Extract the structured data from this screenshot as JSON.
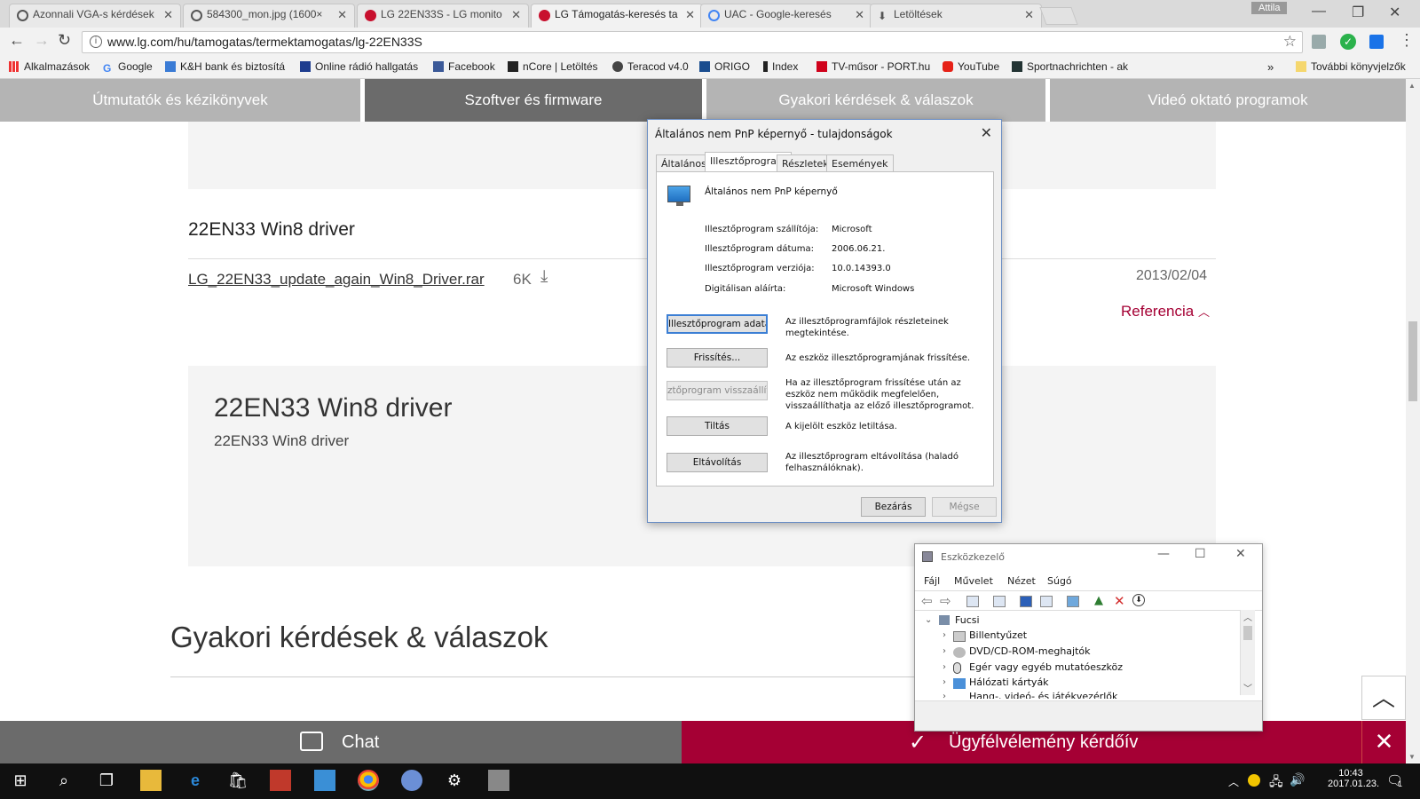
{
  "browser": {
    "tabs": [
      {
        "title": "Azonnali VGA-s kérdések",
        "active": false
      },
      {
        "title": "584300_mon.jpg (1600×",
        "active": false
      },
      {
        "title": "LG 22EN33S - LG monito",
        "active": false
      },
      {
        "title": "LG Támogatás-keresés ta",
        "active": true
      },
      {
        "title": "UAC - Google-keresés",
        "active": false
      },
      {
        "title": "Letöltések",
        "active": false
      }
    ],
    "user": "Attila",
    "url": "www.lg.com/hu/tamogatas/termektamogatas/lg-22EN33S",
    "bookmarks": [
      "Alkalmazások",
      "Google",
      "K&H bank és biztosítá",
      "Online rádió hallgatás",
      "Facebook",
      "nCore | Letöltés",
      "Teracod v4.0",
      "ORIGO",
      "Index",
      "TV-műsor - PORT.hu",
      "YouTube",
      "Sportnachrichten - ak"
    ],
    "bookmarks_more": "»",
    "other_bookmarks": "További könyvjelzők"
  },
  "lg": {
    "subnav": [
      "Útmutatók és kézikönyvek",
      "Szoftver és firmware",
      "Gyakori kérdések & válaszok",
      "Videó oktató programok"
    ],
    "driver_heading": "22EN33 Win8 driver",
    "file_link": "LG_22EN33_update_again_Win8_Driver.rar",
    "file_size": "6K",
    "file_date": "2013/02/04",
    "reference": "Referencia",
    "box_title": "22EN33 Win8 driver",
    "box_subtitle": "22EN33 Win8 driver",
    "faq_heading": "Gyakori kérdések & válaszok",
    "chat_label": "Chat",
    "survey_label": "Ügyfélvélemény kérdőív",
    "close_symbol": "✕",
    "up_symbol": "︿"
  },
  "dialog": {
    "title": "Általános nem PnP képernyő - tulajdonságok",
    "tabs": [
      "Általános",
      "Illesztőprogram",
      "Részletek",
      "Események"
    ],
    "device_name": "Általános nem PnP képernyő",
    "fields": [
      {
        "label": "Illesztőprogram szállítója:",
        "value": "Microsoft"
      },
      {
        "label": "Illesztőprogram dátuma:",
        "value": "2006.06.21."
      },
      {
        "label": "Illesztőprogram verziója:",
        "value": "10.0.14393.0"
      },
      {
        "label": "Digitálisan aláírta:",
        "value": "Microsoft Windows"
      }
    ],
    "buttons": [
      {
        "label": "Illesztőprogram adatai",
        "desc": "Az illesztőprogramfájlok részleteinek megtekintése."
      },
      {
        "label": "Frissítés...",
        "desc": "Az eszköz illesztőprogramjának frissítése."
      },
      {
        "label": "ztőprogram visszaállítás",
        "desc": "Ha az illesztőprogram frissítése után az eszköz nem működik megfelelően, visszaállíthatja az előző illesztőprogramot."
      },
      {
        "label": "Tiltás",
        "desc": "A kijelölt eszköz letiltása."
      },
      {
        "label": "Eltávolítás",
        "desc": "Az illesztőprogram eltávolítása (haladó felhasználóknak)."
      }
    ],
    "ok": "Bezárás",
    "cancel": "Mégse"
  },
  "devmgr": {
    "title": "Eszközkezelő",
    "menu": [
      "Fájl",
      "Művelet",
      "Nézet",
      "Súgó"
    ],
    "root": "Fucsi",
    "items": [
      "Billentyűzet",
      "DVD/CD-ROM-meghajtók",
      "Egér vagy egyéb mutatóeszköz",
      "Hálózati kártyák",
      "Hang-, videó- és játékvezérlők"
    ]
  },
  "taskbar": {
    "time": "10:43",
    "date": "2017.01.23.",
    "notif_count": "1"
  },
  "colors": {
    "lg_red": "#a50034",
    "subnav_gray": "#b4b4b4",
    "subnav_active": "#6b6b6b"
  }
}
